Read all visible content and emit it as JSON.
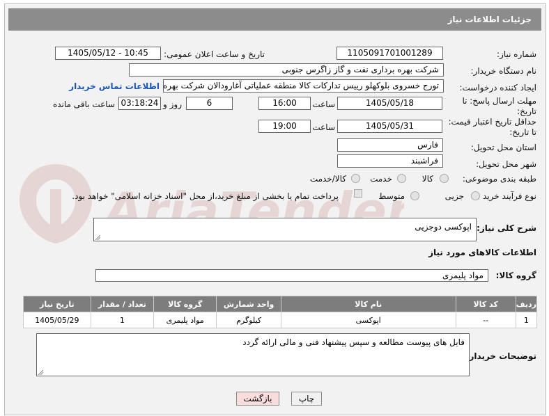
{
  "header": {
    "title": "جزئیات اطلاعات نیاز"
  },
  "labels": {
    "need_number": "شماره نیاز:",
    "announce_datetime": "تاریخ و ساعت اعلان عمومی:",
    "buyer_org": "نام دستگاه خریدار:",
    "requester": "ایجاد کننده درخواست:",
    "response_deadline": "مهلت ارسال پاسخ: تا تاریخ:",
    "min_price_validity": "حداقل تاریخ اعتبار قیمت: تا تاریخ:",
    "time": "ساعت",
    "days_and": "روز و",
    "remaining": "ساعت باقی مانده",
    "province": "استان محل تحویل:",
    "city": "شهر محل تحویل:",
    "category": "طبقه بندی موضوعی:",
    "process_type": "نوع فرآیند خرید :",
    "description_title": "شرح کلی نیاز:",
    "goods_info_title": "اطلاعات کالاهای مورد نیاز",
    "goods_group": "گروه کالا:",
    "buyer_notes": "توضیحات خریدار:"
  },
  "fields": {
    "need_number": "1105091701001289",
    "announce_datetime": "1405/05/12 - 10:45",
    "buyer_org": "شرکت بهره برداری نفت و گاز زاگرس جنوبی",
    "requester": "تورج خسروی بلوکهلو رییس تدارکات کالا منطقه عملیاتی آغارودالان شرکت بهره ب",
    "contact_link": "اطلاعات تماس خریدار",
    "response_date": "1405/05/18",
    "response_time": "16:00",
    "days": "6",
    "remaining_time": "03:18:24",
    "validity_date": "1405/05/31",
    "validity_time": "19:00",
    "province": "فارس",
    "city": "فراشبند",
    "description": "اپوکسی دوجزیی",
    "goods_group": "مواد پلیمری",
    "buyer_notes": "فایل های پیوست مطالعه و سپس پیشنهاد فنی و مالی ارائه گردد"
  },
  "category_options": [
    "کالا",
    "خدمت",
    "کالا/خدمت"
  ],
  "process_options": [
    "جزیی",
    "متوسط"
  ],
  "payment_note": "پرداخت تمام یا بخشی از مبلغ خرید،از محل \"اسناد خزانه اسلامی\" خواهد بود.",
  "table": {
    "headers": [
      "ردیف",
      "کد کالا",
      "نام کالا",
      "واحد شمارش",
      "گروه کالا",
      "تعداد / مقدار",
      "تاریخ نیاز"
    ],
    "rows": [
      [
        "1",
        "--",
        "اپوکسی",
        "کیلوگرم",
        "مواد پلیمری",
        "1",
        "1405/05/29"
      ]
    ]
  },
  "buttons": {
    "print": "چاپ",
    "back": "بازگشت"
  },
  "watermark": "AriaTender.neT",
  "colors": {
    "header_bg": "#8c8c8c",
    "link": "#1b56b5",
    "back_button_bg": "#f9dcdc"
  }
}
